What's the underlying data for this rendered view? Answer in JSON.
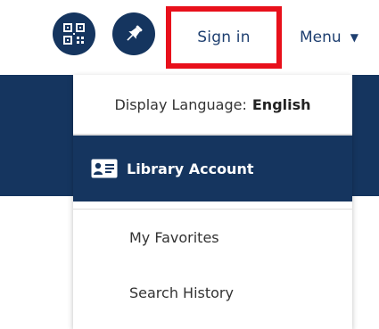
{
  "header": {
    "qr_icon": "qr-code-icon",
    "pin_icon": "pushpin-icon",
    "signin_label": "Sign in",
    "menu_label": "Menu",
    "menu_caret": "▼"
  },
  "dropdown": {
    "language_prefix": "Display Language:",
    "language_value": "English",
    "account_icon": "id-card-icon",
    "account_label": "Library Account",
    "items": [
      {
        "label": "My Favorites"
      },
      {
        "label": "Search History"
      }
    ]
  },
  "colors": {
    "navy": "#15355f",
    "highlight_border": "#e8101b",
    "link_text": "#1e3f70"
  }
}
